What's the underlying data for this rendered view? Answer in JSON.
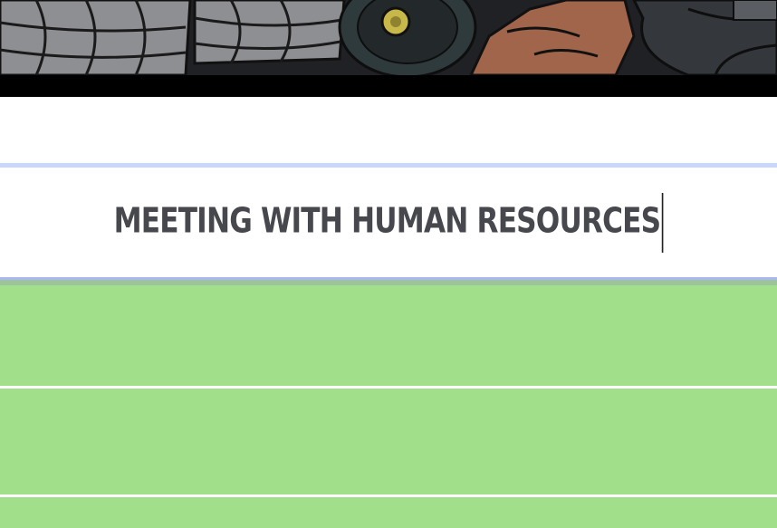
{
  "banner": {
    "icon": "illustration-banner",
    "colors": {
      "dark": "#2a2c2f",
      "metal": "#8a8c90",
      "accent": "#c8b84a",
      "skin": "#a0654a"
    }
  },
  "editor": {
    "title_text": "MEETING WITH HUMAN RESOURCES",
    "text_color": "#46484d"
  },
  "rows": {
    "color": "#a2df8a",
    "count": 3
  }
}
